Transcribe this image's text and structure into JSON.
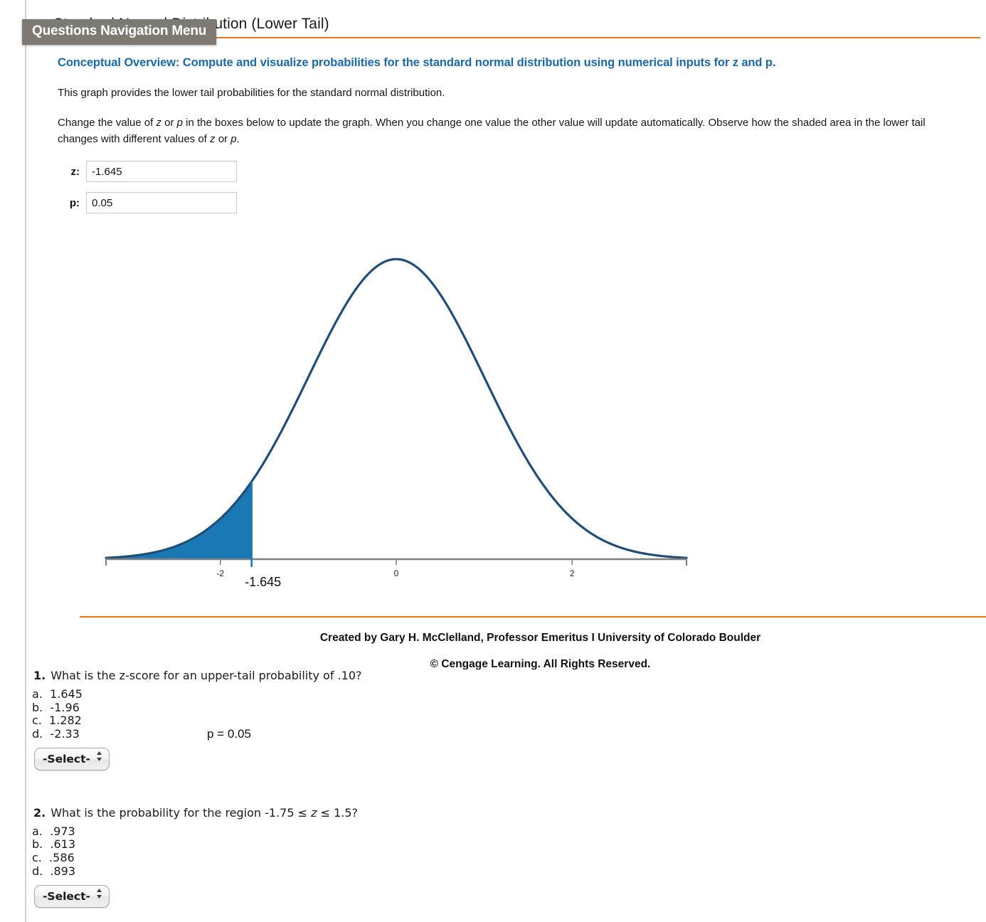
{
  "tooltip": {
    "label": "Questions Navigation Menu"
  },
  "header": {
    "title": "Standard Normal Distribution (Lower Tail)",
    "rule_color": "#e8741c"
  },
  "overview": {
    "heading": "Conceptual Overview: Compute and visualize probabilities for the standard normal distribution using numerical inputs for z and p.",
    "heading_color": "#1a6aa8",
    "paragraph1": "This graph provides the lower tail probabilities for the standard normal distribution.",
    "paragraph2_a": "Change the value of ",
    "paragraph2_z": "z",
    "paragraph2_b": " or ",
    "paragraph2_p": "p",
    "paragraph2_c": " in the boxes below to update the graph. When you change one value the other value will update automatically. Observe how the shaded area in the lower tail changes with different values of ",
    "paragraph2_z2": "z",
    "paragraph2_d": " or ",
    "paragraph2_p2": "p",
    "paragraph2_e": "."
  },
  "inputs": {
    "z_label": "z:",
    "z_value": "-1.645",
    "p_label": "p:",
    "p_value": "0.05"
  },
  "chart_data": {
    "type": "area",
    "title": "Standard Normal Distribution (Lower Tail)",
    "xlabel": "",
    "ylabel": "",
    "xlim": [
      -3.3,
      3.3
    ],
    "ylim": [
      0,
      0.42
    ],
    "grid": false,
    "tick_labels": [
      "-2",
      "0",
      "2"
    ],
    "tick_values": [
      -2,
      0,
      2
    ],
    "z": -1.645,
    "p": 0.05,
    "z_annotation": "-1.645",
    "p_annotation": "p = 0.05",
    "curve_color": "#1f4e79",
    "fill_color": "#1a79b5",
    "axis_color": "#808080",
    "distribution": "standard normal (mean 0, sd 1)",
    "shaded_region": "lower tail, z <= -1.645, area = 0.05"
  },
  "footer": {
    "credit": "Created by Gary H. McClelland, Professor Emeritus I University of Colorado Boulder",
    "copyright": "© Cengage Learning. All Rights Reserved."
  },
  "questions": [
    {
      "number": "1.",
      "stem_a": "What is the z-score for an upper-tail probability of .10?",
      "choices": [
        "a.  1.645",
        "b.  -1.96",
        "c.  1.282",
        "d.  -2.33"
      ],
      "select_label": "-Select-"
    },
    {
      "number": "2.",
      "stem_a": "What is the probability for the region -1.75 ≤ ",
      "stem_z": "z",
      "stem_b": " ≤ 1.5?",
      "choices": [
        "a.  .973",
        "b.  .613",
        "c.  .586",
        "d.  .893"
      ],
      "select_label": "-Select-"
    }
  ]
}
